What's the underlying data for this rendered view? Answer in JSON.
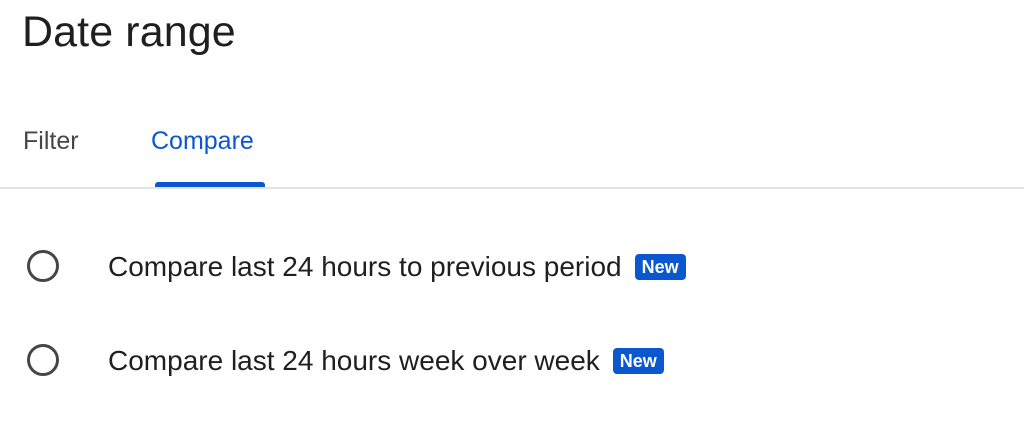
{
  "title": "Date range",
  "tabs": [
    {
      "label": "Filter",
      "selected": false
    },
    {
      "label": "Compare",
      "selected": true
    }
  ],
  "options": [
    {
      "label": "Compare last 24 hours to previous period",
      "badge": "New",
      "selected": false
    },
    {
      "label": "Compare last 24 hours week over week",
      "badge": "New",
      "selected": false
    }
  ],
  "colors": {
    "accent": "#0b57d0",
    "text": "#1f1f1f",
    "muted_text": "#444746",
    "divider": "#e3e3e3"
  },
  "icons": {
    "radio": "radio-unchecked-icon"
  }
}
